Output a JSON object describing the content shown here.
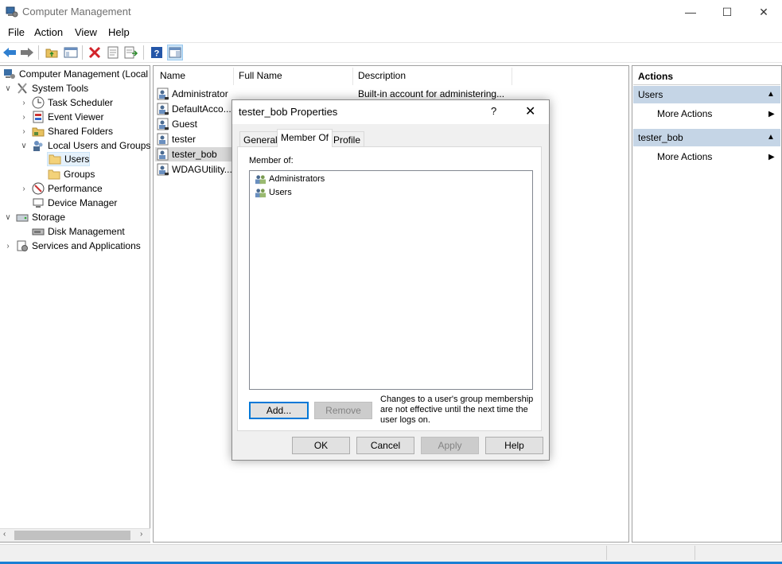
{
  "window": {
    "title": "Computer Management",
    "controls": {
      "minimize": "—",
      "maximize": "☐",
      "close": "✕"
    }
  },
  "menu": [
    "File",
    "Action",
    "View",
    "Help"
  ],
  "toolbar_icons": [
    "back-arrow-icon",
    "forward-arrow-icon",
    "up-folder-icon",
    "show-hide-tree-icon",
    "delete-icon",
    "properties-icon",
    "export-list-icon",
    "help-icon",
    "action-pane-icon"
  ],
  "tree": {
    "root": "Computer Management (Local",
    "system_tools": "System Tools",
    "task_scheduler": "Task Scheduler",
    "event_viewer": "Event Viewer",
    "shared_folders": "Shared Folders",
    "local_users_groups": "Local Users and Groups",
    "users": "Users",
    "groups": "Groups",
    "performance": "Performance",
    "device_manager": "Device Manager",
    "storage": "Storage",
    "disk_management": "Disk Management",
    "services_apps": "Services and Applications"
  },
  "list": {
    "columns": [
      "Name",
      "Full Name",
      "Description"
    ],
    "rows": [
      {
        "name": "Administrator",
        "description": "Built-in account for administering..."
      },
      {
        "name": "DefaultAcco...",
        "description": ""
      },
      {
        "name": "Guest",
        "description": ""
      },
      {
        "name": "tester",
        "description": ""
      },
      {
        "name": "tester_bob",
        "description": ""
      },
      {
        "name": "WDAGUtility...",
        "description": ""
      }
    ]
  },
  "actions": {
    "header": "Actions",
    "section1": "Users",
    "section1_item": "More Actions",
    "section2": "tester_bob",
    "section2_item": "More Actions"
  },
  "dialog": {
    "title": "tester_bob Properties",
    "help": "?",
    "close": "✕",
    "tabs": [
      "General",
      "Member Of",
      "Profile"
    ],
    "member_of_label": "Member of:",
    "members": [
      "Administrators",
      "Users"
    ],
    "add_button": "Add...",
    "remove_button": "Remove",
    "note": "Changes to a user's group membership are not effective until the next time the user logs on.",
    "ok_button": "OK",
    "cancel_button": "Cancel",
    "apply_button": "Apply",
    "help_button": "Help"
  },
  "colors": {
    "accent": "#0078d7",
    "selection": "#e5f1fb",
    "section_header": "#c5d5e6"
  }
}
